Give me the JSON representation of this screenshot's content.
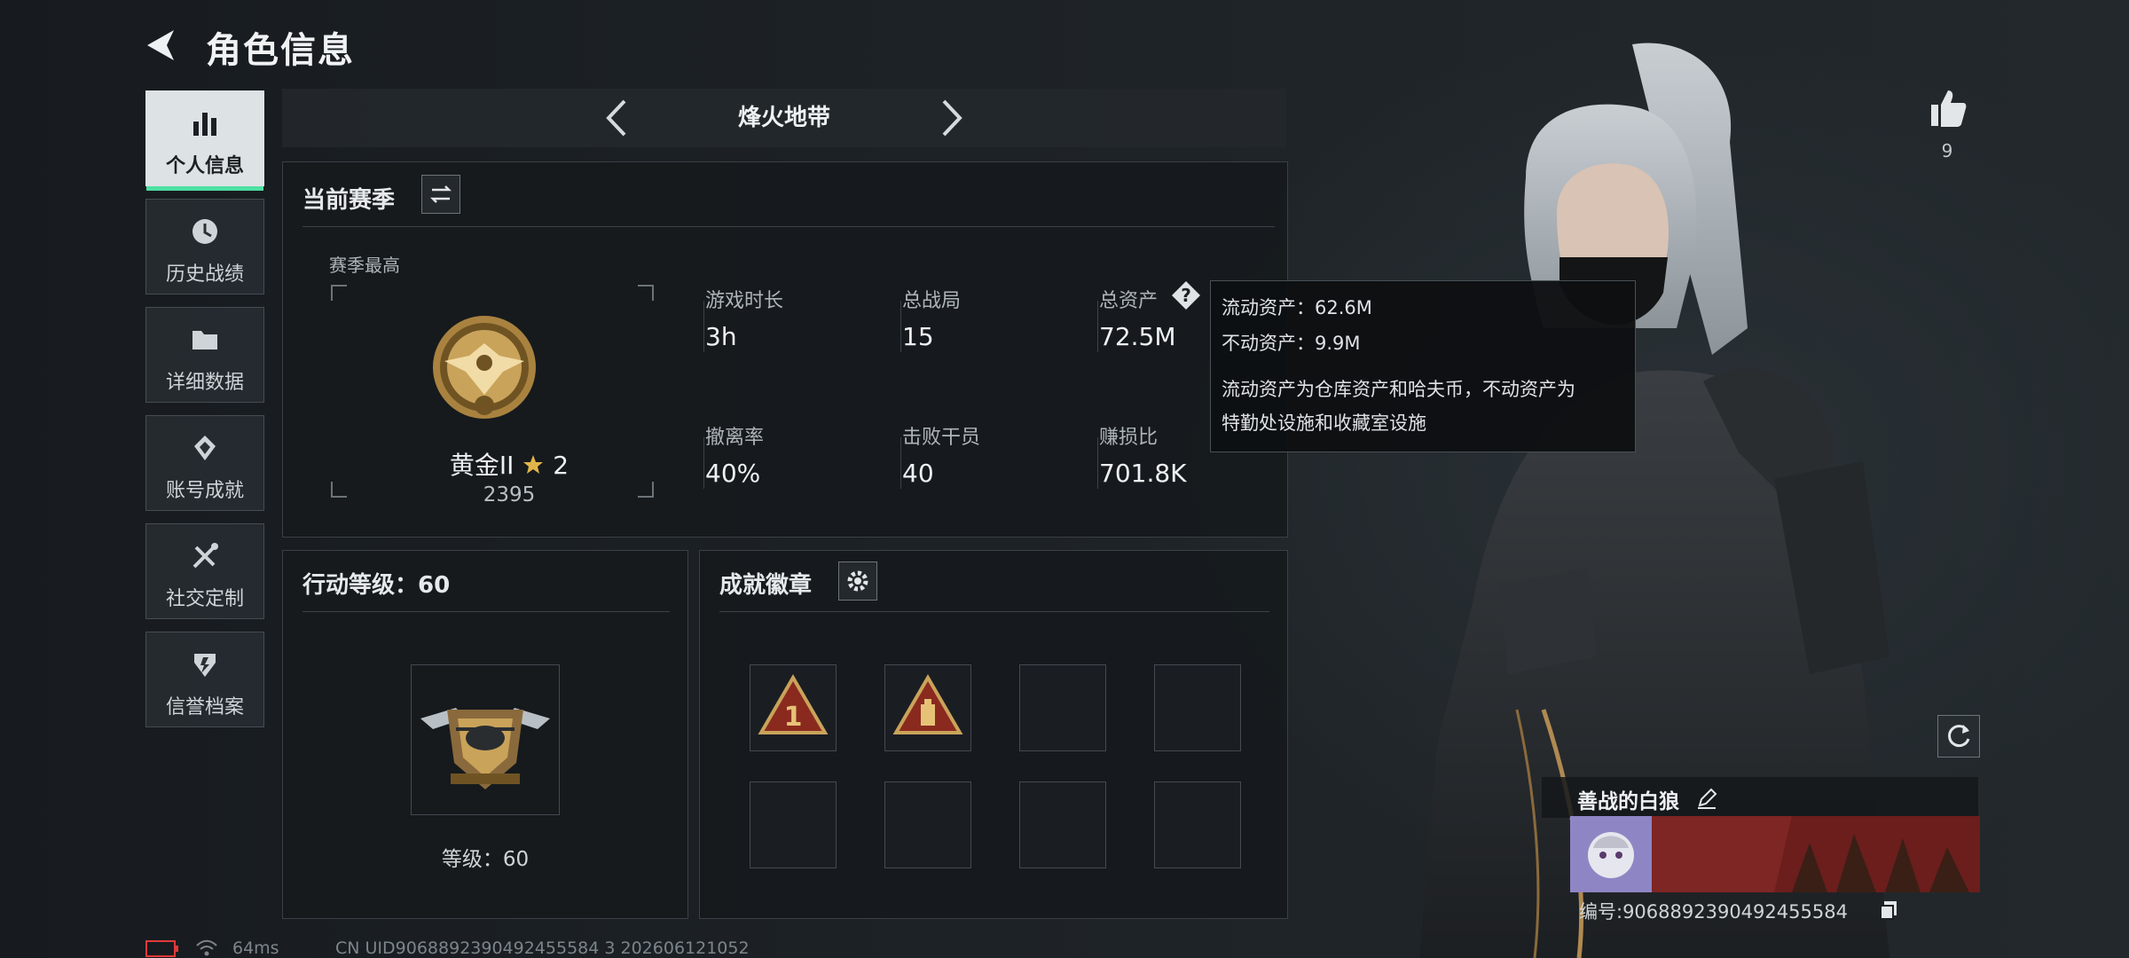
{
  "app": {
    "title": "角色信息",
    "mode": "烽火地带"
  },
  "nav": {
    "items": [
      {
        "label": "个人信息",
        "icon": "bar-chart-icon",
        "active": true
      },
      {
        "label": "历史战绩",
        "icon": "clock-icon",
        "active": false
      },
      {
        "label": "详细数据",
        "icon": "folder-icon",
        "active": false
      },
      {
        "label": "账号成就",
        "icon": "achievement-icon",
        "active": false
      },
      {
        "label": "社交定制",
        "icon": "tools-icon",
        "active": false
      },
      {
        "label": "信誉档案",
        "icon": "shield-icon",
        "active": false
      }
    ]
  },
  "season": {
    "title": "当前赛季",
    "best_label": "赛季最高",
    "rank_name": "黄金II",
    "rank_stars": "2",
    "rank_score": "2395",
    "stats": [
      {
        "label": "游戏时长",
        "value": "3h"
      },
      {
        "label": "总战局",
        "value": "15"
      },
      {
        "label": "总资产",
        "value": "72.5M"
      },
      {
        "label": "撤离率",
        "value": "40%"
      },
      {
        "label": "击败干员",
        "value": "40"
      },
      {
        "label": "赚损比",
        "value": "701.8K"
      }
    ]
  },
  "tooltip": {
    "liquid": "流动资产：62.6M",
    "fixed": "不动资产：9.9M",
    "desc_line1": "流动资产为仓库资产和哈夫币，不动资产为",
    "desc_line2": "特勤处设施和收藏室设施"
  },
  "level": {
    "title": "行动等级：60",
    "caption": "等级：60"
  },
  "badges": {
    "title": "成就徽章",
    "filled_count": 2
  },
  "profile": {
    "likes": "9",
    "nickname": "善战的白狼",
    "id_text": "编号:9068892390492455584"
  },
  "footer": {
    "ping": "64ms",
    "uid": "CN UID9068892390492455584 3 202606121052"
  },
  "colors": {
    "accent": "#4ee0a2",
    "gold": "#c9a35a",
    "battery": "#e03a3a"
  }
}
